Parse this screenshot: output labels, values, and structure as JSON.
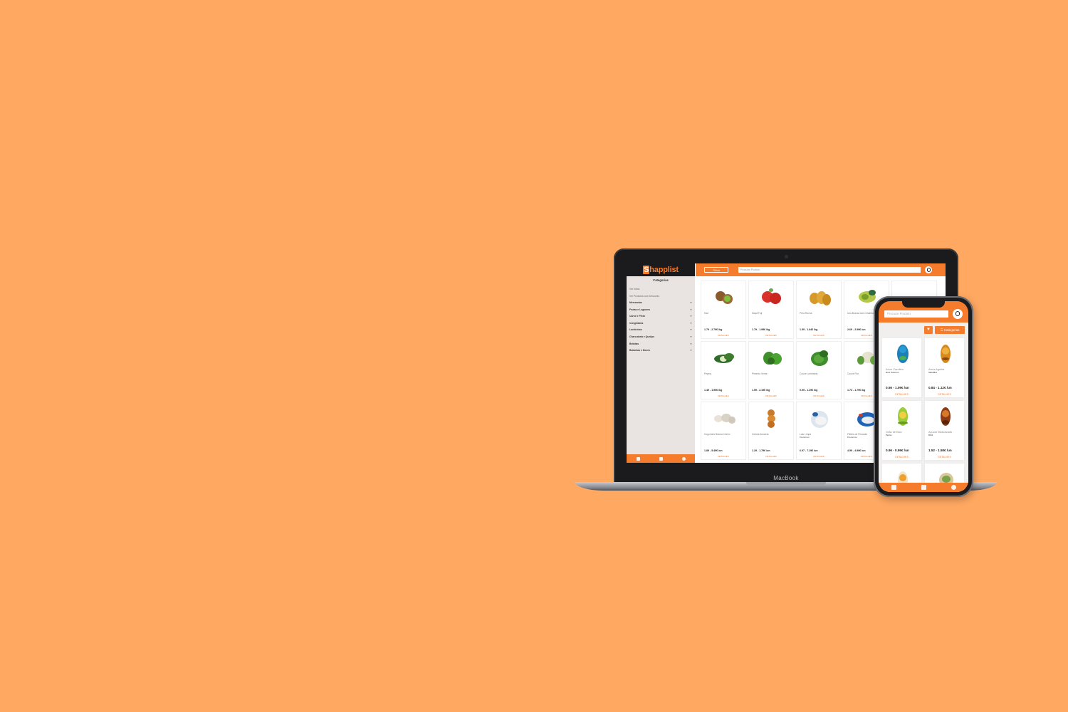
{
  "colors": {
    "background": "#FFA862",
    "accent": "#F47C2C"
  },
  "desktop": {
    "logo": "Shapplist",
    "logo_initial": "S",
    "logo_rest": "happlist",
    "filter_label": "Filtros",
    "search_placeholder": "Procurar Produto",
    "sidebar": {
      "title": "Categorias",
      "links": [
        "Ver todos",
        "Ver Produtos com Desconto"
      ],
      "categories": [
        "Mercearias",
        "Frutas e Legumes",
        "Carne e Peixe",
        "Congelados",
        "Lacticínios",
        "Charcutaria e Queijos",
        "Bebidas",
        "Bolachas e Doces"
      ]
    },
    "products": [
      {
        "name": "Kiwi",
        "brand": "",
        "price": "1.79 - 2.79€ /kg",
        "icon": "kiwi"
      },
      {
        "name": "Maçã Fuji",
        "brand": "",
        "price": "1.79 - 1.99€ /kg",
        "icon": "apple"
      },
      {
        "name": "Pêra Rocha",
        "brand": "",
        "price": "1.59 - 1.64€ /kg",
        "icon": "pear"
      },
      {
        "name": "Uva Branca sem Grainha",
        "brand": "",
        "price": "2.69 - 2.99€ /un",
        "icon": "grape"
      },
      {
        "name": "",
        "brand": "",
        "price": "",
        "icon": ""
      },
      {
        "name": "Pepino",
        "brand": "",
        "price": "1.49 - 1.99€ /kg",
        "icon": "cucumber"
      },
      {
        "name": "Pimento Verde",
        "brand": "",
        "price": "1.99 - 2.19€ /kg",
        "icon": "pepper"
      },
      {
        "name": "Couve Lombarda",
        "brand": "",
        "price": "0.99 - 1.29€ /kg",
        "icon": "cabbage"
      },
      {
        "name": "Couve Flor",
        "brand": "",
        "price": "1.73 - 1.79€ /kg",
        "icon": "cauliflower"
      },
      {
        "name": "",
        "brand": "",
        "price": "",
        "icon": ""
      },
      {
        "name": "Cogumelo Branco Inteiro",
        "brand": "",
        "price": "1.89 - 5.49€ /un",
        "icon": "mushroom"
      },
      {
        "name": "Cebola Amarela",
        "brand": "",
        "price": "1.29 - 1.79€ /un",
        "icon": "onion"
      },
      {
        "name": "Lulu Limpa",
        "brand": "Pescanova",
        "price": "6.97 - 7.19€ /un",
        "icon": "frozen-pack"
      },
      {
        "name": "Filetes de Pescada",
        "brand": "Pescanova",
        "price": "4.59 - 4.99€ /un",
        "icon": "fish-pack"
      },
      {
        "name": "",
        "brand": "",
        "price": "",
        "icon": ""
      }
    ],
    "details_label": "DETALHES",
    "device_label": "MacBook"
  },
  "mobile": {
    "search_placeholder": "Procurar Produto",
    "categories_label": "☰ Categorias",
    "products": [
      {
        "name": "Arroz Carolino",
        "brand": "Bom Sucesso",
        "price": "0.56 - 1.09€ /un",
        "icon": "rice-bag"
      },
      {
        "name": "Arroz Agulha",
        "brand": "Saludães",
        "price": "0.84 - 1.12€ /un",
        "icon": "rice-bag-2"
      },
      {
        "name": "Grão de Bico",
        "brand": "Pertus",
        "price": "0.96 - 0.99€ /un",
        "icon": "chickpea-can"
      },
      {
        "name": "Açúcar Mascavado",
        "brand": "Rifol",
        "price": "1.52 - 1.58€ /un",
        "icon": "sugar-pack"
      },
      {
        "name": "",
        "brand": "",
        "price": "",
        "icon": "jar"
      },
      {
        "name": "",
        "brand": "",
        "price": "",
        "icon": "box"
      }
    ],
    "details_label": "DETALHES"
  }
}
